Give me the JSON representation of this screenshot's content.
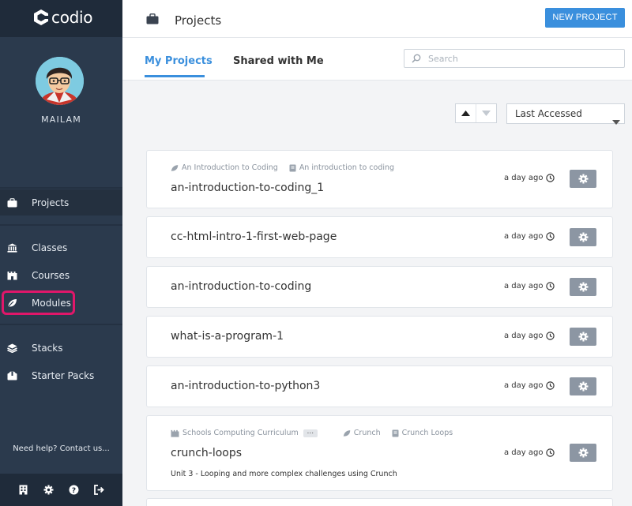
{
  "app": {
    "brand": "codio"
  },
  "user": {
    "name": "MAILAM"
  },
  "sidebar": {
    "items": [
      {
        "label": "Projects",
        "icon": "briefcase-icon",
        "active": true
      },
      {
        "label": "Classes",
        "icon": "institution-icon"
      },
      {
        "label": "Courses",
        "icon": "castle-icon"
      },
      {
        "label": "Modules",
        "icon": "leaf-icon",
        "highlighted": true
      },
      {
        "label": "Stacks",
        "icon": "layers-icon"
      },
      {
        "label": "Starter Packs",
        "icon": "box-icon"
      }
    ],
    "help": "Need help? Contact us...",
    "bottom_icons": [
      "building-icon",
      "gear-icon",
      "question-icon",
      "logout-icon"
    ]
  },
  "header": {
    "title": "Projects",
    "new_button": "NEW PROJECT"
  },
  "tabs": [
    {
      "label": "My Projects",
      "active": true
    },
    {
      "label": "Shared with Me",
      "active": false
    }
  ],
  "search": {
    "placeholder": "Search",
    "value": ""
  },
  "sort": {
    "selected": "Last Accessed"
  },
  "projects": [
    {
      "name": "an-introduction-to-coding_1",
      "time": "a day ago",
      "meta": [
        "An Introduction to Coding",
        "An introduction to coding"
      ]
    },
    {
      "name": "cc-html-intro-1-first-web-page",
      "time": "a day ago"
    },
    {
      "name": "an-introduction-to-coding",
      "time": "a day ago"
    },
    {
      "name": "what-is-a-program-1",
      "time": "a day ago"
    },
    {
      "name": "an-introduction-to-python3",
      "time": "a day ago"
    },
    {
      "name": "crunch-loops",
      "time": "a day ago",
      "meta": [
        "Schools Computing Curriculum",
        "Crunch",
        "Crunch Loops"
      ],
      "more": "...",
      "description": "Unit 3 - Looping and more complex challenges using Crunch"
    }
  ],
  "colors": {
    "accent": "#3a8fdd",
    "sidebar": "#2b3a4d",
    "highlight": "#e0176a"
  }
}
